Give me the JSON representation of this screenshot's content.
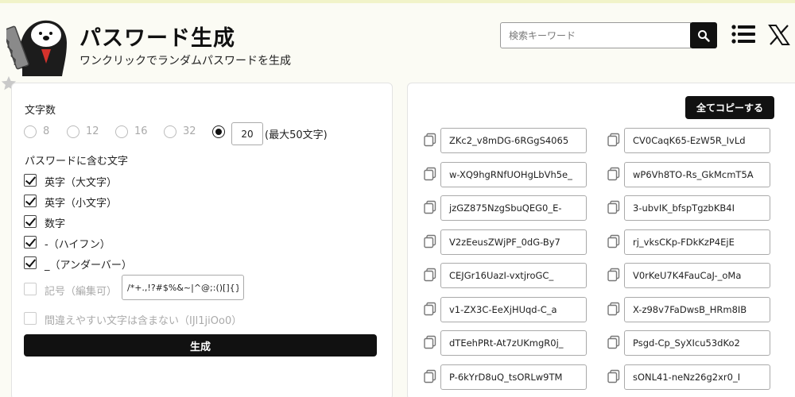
{
  "header": {
    "title": "パスワード生成",
    "subtitle": "ワンクリックでランダムパスワードを生成",
    "search_placeholder": "検索キーワード"
  },
  "options": {
    "length_label": "文字数",
    "length_choices": [
      "8",
      "12",
      "16",
      "32"
    ],
    "selected": "custom",
    "custom_length": "20",
    "custom_note": "(最大50文字)",
    "charset_label": "パスワードに含む文字",
    "checkboxes": [
      {
        "label": "英字（大文字）",
        "checked": true,
        "disabled": false
      },
      {
        "label": "英字（小文字）",
        "checked": true,
        "disabled": false
      },
      {
        "label": "数字",
        "checked": true,
        "disabled": false
      },
      {
        "label": "-（ハイフン）",
        "checked": true,
        "disabled": false
      },
      {
        "label": "_（アンダーバー）",
        "checked": true,
        "disabled": false
      },
      {
        "label": "記号（編集可）",
        "checked": false,
        "disabled": true
      },
      {
        "label": "間違えやすい文字は含まない（IJl1jiOo0）",
        "checked": false,
        "disabled": true
      }
    ],
    "symbols_value": "/*+.,!?#$%&~|^@;:()[]{}",
    "generate_label": "生成"
  },
  "results": {
    "copy_all_label": "全てコピーする",
    "passwords": [
      "ZKc2_v8mDG-6RGgS4065",
      "CV0CaqK65-EzW5R_IvLd",
      "w-XQ9hgRNfUOHgLbVh5e_",
      "wP6Vh8TO-Rs_GkMcmT5A",
      "jzGZ875NzgSbuQEG0_E-",
      "3-ubvIK_bfspTgzbKB4I",
      "V2zEeusZWjPF_0dG-By7",
      "rj_vksCKp-FDkKzP4EjE",
      "CEJGr16UazI-vxtjroGC_",
      "V0rKeU7K4FauCaJ-_oMa",
      "v1-ZX3C-EeXjHUqd-C_a",
      "X-z98v7FaDwsB_HRm8IB",
      "dTEehPRt-At7zUKmgR0j_",
      "Psgd-Cp_SyXIcu53dKo2",
      "P-6kYrD8uQ_tsORLw9TM",
      "sONL41-neNz26g2xr0_I"
    ]
  },
  "icons": {
    "search": "search-icon",
    "menu": "hamburger-menu-icon",
    "x": "x-logo-icon",
    "copy": "copy-icon"
  },
  "colors": {
    "background": "#fbfbf4",
    "accent": "#111111"
  }
}
